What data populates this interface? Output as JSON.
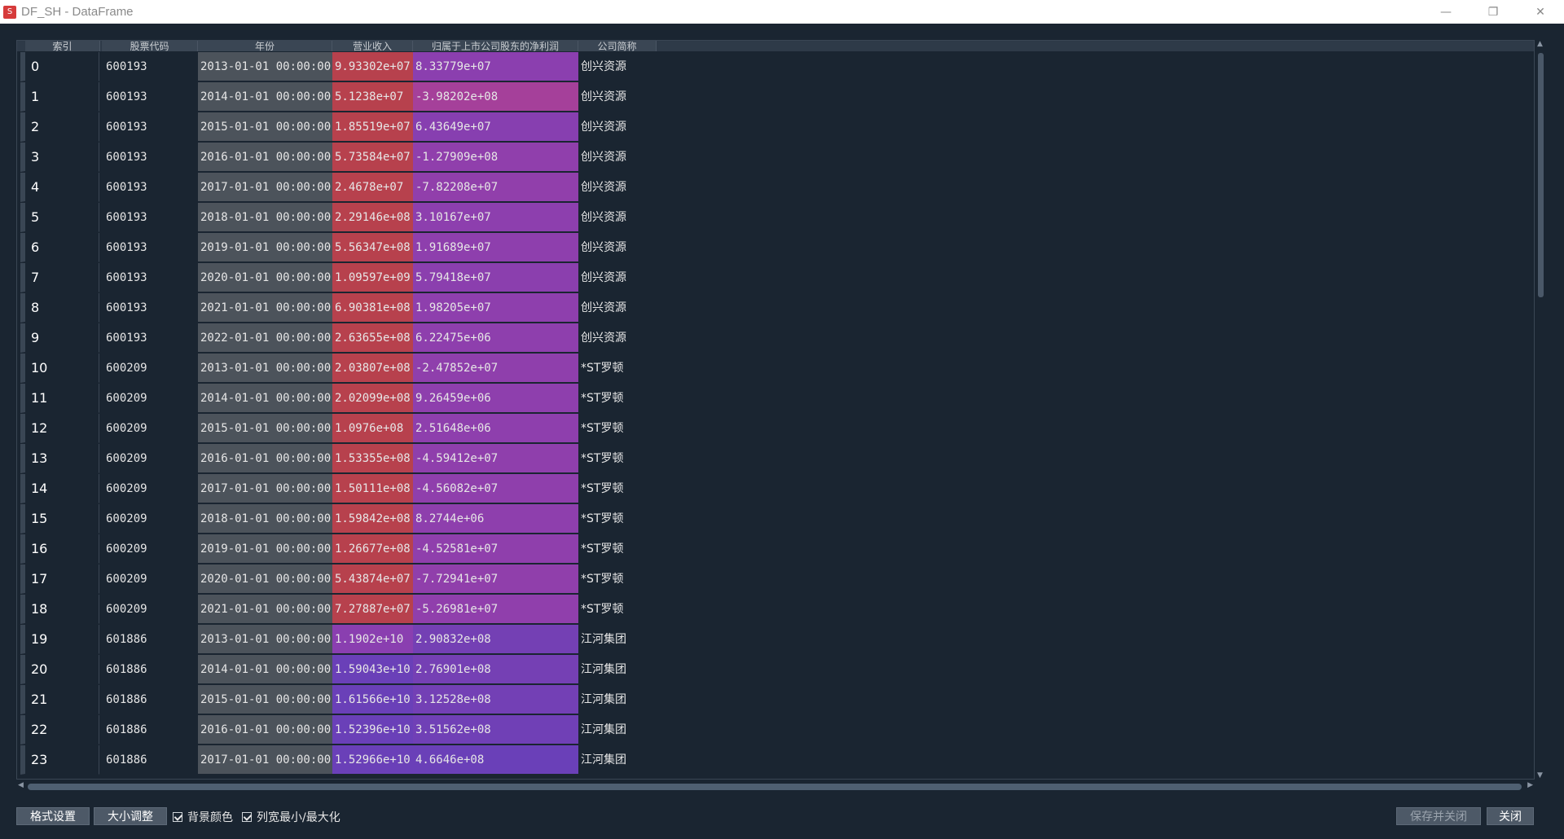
{
  "window": {
    "title": "DF_SH - DataFrame",
    "icon": "app-icon",
    "controls": [
      "minimize-icon",
      "restore-icon",
      "close-icon"
    ]
  },
  "table": {
    "headers": [
      "索引",
      "股票代码",
      "年份",
      "营业收入",
      "归属于上市公司股东的净利润",
      "公司简称"
    ],
    "rows": [
      [
        "0",
        "600193",
        "2013-01-01 00:00:00",
        "9.93302e+07",
        "8.33779e+07",
        "创兴资源"
      ],
      [
        "1",
        "600193",
        "2014-01-01 00:00:00",
        "5.1238e+07",
        "-3.98202e+08",
        "创兴资源"
      ],
      [
        "2",
        "600193",
        "2015-01-01 00:00:00",
        "1.85519e+07",
        "6.43649e+07",
        "创兴资源"
      ],
      [
        "3",
        "600193",
        "2016-01-01 00:00:00",
        "5.73584e+07",
        "-1.27909e+08",
        "创兴资源"
      ],
      [
        "4",
        "600193",
        "2017-01-01 00:00:00",
        "2.4678e+07",
        "-7.82208e+07",
        "创兴资源"
      ],
      [
        "5",
        "600193",
        "2018-01-01 00:00:00",
        "2.29146e+08",
        "3.10167e+07",
        "创兴资源"
      ],
      [
        "6",
        "600193",
        "2019-01-01 00:00:00",
        "5.56347e+08",
        "1.91689e+07",
        "创兴资源"
      ],
      [
        "7",
        "600193",
        "2020-01-01 00:00:00",
        "1.09597e+09",
        "5.79418e+07",
        "创兴资源"
      ],
      [
        "8",
        "600193",
        "2021-01-01 00:00:00",
        "6.90381e+08",
        "1.98205e+07",
        "创兴资源"
      ],
      [
        "9",
        "600193",
        "2022-01-01 00:00:00",
        "2.63655e+08",
        "6.22475e+06",
        "创兴资源"
      ],
      [
        "10",
        "600209",
        "2013-01-01 00:00:00",
        "2.03807e+08",
        "-2.47852e+07",
        "*ST罗顿"
      ],
      [
        "11",
        "600209",
        "2014-01-01 00:00:00",
        "2.02099e+08",
        "9.26459e+06",
        "*ST罗顿"
      ],
      [
        "12",
        "600209",
        "2015-01-01 00:00:00",
        "1.0976e+08",
        "2.51648e+06",
        "*ST罗顿"
      ],
      [
        "13",
        "600209",
        "2016-01-01 00:00:00",
        "1.53355e+08",
        "-4.59412e+07",
        "*ST罗顿"
      ],
      [
        "14",
        "600209",
        "2017-01-01 00:00:00",
        "1.50111e+08",
        "-4.56082e+07",
        "*ST罗顿"
      ],
      [
        "15",
        "600209",
        "2018-01-01 00:00:00",
        "1.59842e+08",
        "8.2744e+06",
        "*ST罗顿"
      ],
      [
        "16",
        "600209",
        "2019-01-01 00:00:00",
        "1.26677e+08",
        "-4.52581e+07",
        "*ST罗顿"
      ],
      [
        "17",
        "600209",
        "2020-01-01 00:00:00",
        "5.43874e+07",
        "-7.72941e+07",
        "*ST罗顿"
      ],
      [
        "18",
        "600209",
        "2021-01-01 00:00:00",
        "7.27887e+07",
        "-5.26981e+07",
        "*ST罗顿"
      ],
      [
        "19",
        "601886",
        "2013-01-01 00:00:00",
        "1.1902e+10",
        "2.90832e+08",
        "江河集团"
      ],
      [
        "20",
        "601886",
        "2014-01-01 00:00:00",
        "1.59043e+10",
        "2.76901e+08",
        "江河集团"
      ],
      [
        "21",
        "601886",
        "2015-01-01 00:00:00",
        "1.61566e+10",
        "3.12528e+08",
        "江河集团"
      ],
      [
        "22",
        "601886",
        "2016-01-01 00:00:00",
        "1.52396e+10",
        "3.51562e+08",
        "江河集团"
      ],
      [
        "23",
        "601886",
        "2017-01-01 00:00:00",
        "1.52966e+10",
        "4.6646e+08",
        "江河集团"
      ]
    ],
    "revenue_colors": [
      "#b7414d",
      "#b7414d",
      "#b7414d",
      "#b7414d",
      "#b7414d",
      "#b7414d",
      "#b7414d",
      "#b7414d",
      "#b7414d",
      "#b7414d",
      "#b7414d",
      "#b7414d",
      "#b7414d",
      "#b7414d",
      "#b7414d",
      "#b7414d",
      "#b7414d",
      "#b7414d",
      "#b7414d",
      "#8a3fb0",
      "#6a40b8",
      "#6a40b8",
      "#6a40b8",
      "#6a40b8"
    ],
    "profit_colors": [
      "#8b3faf",
      "#a5409a",
      "#873fb0",
      "#903fac",
      "#913fab",
      "#8d3fae",
      "#8e3fad",
      "#8b3fae",
      "#8e3fad",
      "#8e3fad",
      "#8f3fac",
      "#8e3fad",
      "#8e3fad",
      "#8f3fac",
      "#8f3fac",
      "#8e3fad",
      "#8f3fac",
      "#903fab",
      "#903fac",
      "#7440b4",
      "#7540b4",
      "#7340b5",
      "#7040b6",
      "#6a40b8"
    ]
  },
  "footer": {
    "format_button": "格式设置",
    "resize_button": "大小调整",
    "bg_color_label": "背景颜色",
    "col_width_label": "列宽最小/最大化",
    "save_close_button": "保存并关闭",
    "close_button": "关闭"
  }
}
